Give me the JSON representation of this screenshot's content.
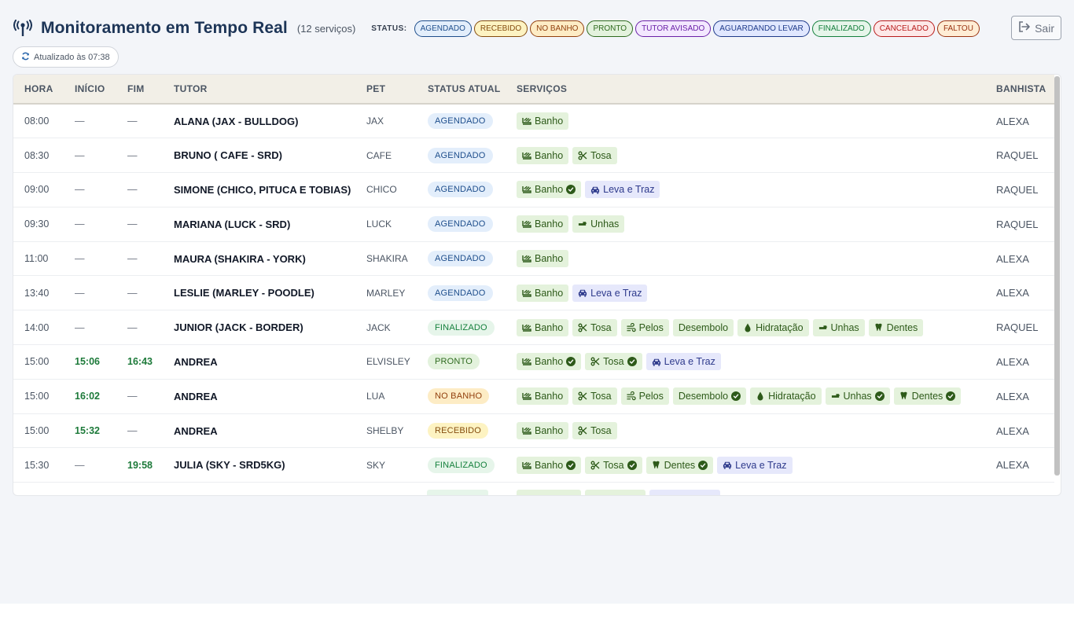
{
  "header": {
    "title": "Monitoramento em Tempo Real",
    "count": "(12 serviços)",
    "status_label": "STATUS:",
    "legend": [
      {
        "label": "AGENDADO",
        "color": "#1e4e8c",
        "bg": "#e3eefb"
      },
      {
        "label": "RECEBIDO",
        "color": "#854d0e",
        "bg": "#fdf3c2"
      },
      {
        "label": "NO BANHO",
        "color": "#92400e",
        "bg": "#fdecc5"
      },
      {
        "label": "PRONTO",
        "color": "#2f6b1f",
        "bg": "#e3f2dd"
      },
      {
        "label": "TUTOR AVISADO",
        "color": "#6b21a8",
        "bg": "#f3e8ff"
      },
      {
        "label": "AGUARDANDO LEVAR",
        "color": "#1e3a8a",
        "bg": "#e0e7ff"
      },
      {
        "label": "FINALIZADO",
        "color": "#15803d",
        "bg": "#e6f5ea"
      },
      {
        "label": "CANCELADO",
        "color": "#b91c1c",
        "bg": "#fde8e8"
      },
      {
        "label": "FALTOU",
        "color": "#9a3412",
        "bg": "#ffedd5"
      }
    ],
    "logout_label": "Sair"
  },
  "updated_label": "Atualizado às 07:38",
  "table": {
    "columns": [
      "HORA",
      "INÍCIO",
      "FIM",
      "TUTOR",
      "PET",
      "STATUS ATUAL",
      "SERVIÇOS",
      "BANHISTA"
    ],
    "rows": [
      {
        "hora": "08:00",
        "inicio": "—",
        "fim": "—",
        "tutor": "ALANA (JAX - BULLDOG)",
        "pet": "JAX",
        "status": "AGENDADO",
        "status_key": "agendado",
        "servicos": [
          {
            "label": "Banho",
            "icon": "bath-icon",
            "done": false
          }
        ],
        "banhista": "ALEXA"
      },
      {
        "hora": "08:30",
        "inicio": "—",
        "fim": "—",
        "tutor": "BRUNO ( CAFE - SRD)",
        "pet": "CAFE",
        "status": "AGENDADO",
        "status_key": "agendado",
        "servicos": [
          {
            "label": "Banho",
            "icon": "bath-icon",
            "done": false
          },
          {
            "label": "Tosa",
            "icon": "scissors-icon",
            "done": false
          }
        ],
        "banhista": "RAQUEL"
      },
      {
        "hora": "09:00",
        "inicio": "—",
        "fim": "—",
        "tutor": "SIMONE (CHICO, PITUCA E TOBIAS)",
        "pet": "CHICO",
        "status": "AGENDADO",
        "status_key": "agendado",
        "servicos": [
          {
            "label": "Banho",
            "icon": "bath-icon",
            "done": true
          },
          {
            "label": "Leva e Traz",
            "icon": "car-icon",
            "done": false,
            "transport": true
          }
        ],
        "banhista": "RAQUEL"
      },
      {
        "hora": "09:30",
        "inicio": "—",
        "fim": "—",
        "tutor": "MARIANA (LUCK - SRD)",
        "pet": "LUCK",
        "status": "AGENDADO",
        "status_key": "agendado",
        "servicos": [
          {
            "label": "Banho",
            "icon": "bath-icon",
            "done": false
          },
          {
            "label": "Unhas",
            "icon": "hand-icon",
            "done": false
          }
        ],
        "banhista": "RAQUEL"
      },
      {
        "hora": "11:00",
        "inicio": "—",
        "fim": "—",
        "tutor": "MAURA (SHAKIRA - YORK)",
        "pet": "SHAKIRA",
        "status": "AGENDADO",
        "status_key": "agendado",
        "servicos": [
          {
            "label": "Banho",
            "icon": "bath-icon",
            "done": false
          }
        ],
        "banhista": "ALEXA"
      },
      {
        "hora": "13:40",
        "inicio": "—",
        "fim": "—",
        "tutor": "LESLIE (MARLEY - POODLE)",
        "pet": "MARLEY",
        "status": "AGENDADO",
        "status_key": "agendado",
        "servicos": [
          {
            "label": "Banho",
            "icon": "bath-icon",
            "done": false
          },
          {
            "label": "Leva e Traz",
            "icon": "car-icon",
            "done": false,
            "transport": true
          }
        ],
        "banhista": "ALEXA"
      },
      {
        "hora": "14:00",
        "inicio": "—",
        "fim": "—",
        "tutor": "JUNIOR (JACK - BORDER)",
        "pet": "JACK",
        "status": "FINALIZADO",
        "status_key": "finalizado",
        "servicos": [
          {
            "label": "Banho",
            "icon": "bath-icon",
            "done": false
          },
          {
            "label": "Tosa",
            "icon": "scissors-icon",
            "done": false
          },
          {
            "label": "Pelos",
            "icon": "wind-icon",
            "done": false
          },
          {
            "label": "Desembolo",
            "icon": "",
            "done": false
          },
          {
            "label": "Hidratação",
            "icon": "drop-icon",
            "done": false
          },
          {
            "label": "Unhas",
            "icon": "hand-icon",
            "done": false
          },
          {
            "label": "Dentes",
            "icon": "tooth-icon",
            "done": false
          }
        ],
        "banhista": "RAQUEL"
      },
      {
        "hora": "15:00",
        "inicio": "15:06",
        "fim": "16:43",
        "tutor": "ANDREA",
        "pet": "ELVISLEY",
        "status": "PRONTO",
        "status_key": "pronto",
        "servicos": [
          {
            "label": "Banho",
            "icon": "bath-icon",
            "done": true
          },
          {
            "label": "Tosa",
            "icon": "scissors-icon",
            "done": true
          },
          {
            "label": "Leva e Traz",
            "icon": "car-icon",
            "done": false,
            "transport": true
          }
        ],
        "banhista": "ALEXA"
      },
      {
        "hora": "15:00",
        "inicio": "16:02",
        "fim": "—",
        "tutor": "ANDREA",
        "pet": "LUA",
        "status": "NO BANHO",
        "status_key": "nobanho",
        "servicos": [
          {
            "label": "Banho",
            "icon": "bath-icon",
            "done": false
          },
          {
            "label": "Tosa",
            "icon": "scissors-icon",
            "done": false
          },
          {
            "label": "Pelos",
            "icon": "wind-icon",
            "done": false
          },
          {
            "label": "Desembolo",
            "icon": "",
            "done": true
          },
          {
            "label": "Hidratação",
            "icon": "drop-icon",
            "done": false
          },
          {
            "label": "Unhas",
            "icon": "hand-icon",
            "done": true
          },
          {
            "label": "Dentes",
            "icon": "tooth-icon",
            "done": true
          }
        ],
        "banhista": "ALEXA"
      },
      {
        "hora": "15:00",
        "inicio": "15:32",
        "fim": "—",
        "tutor": "ANDREA",
        "pet": "SHELBY",
        "status": "RECEBIDO",
        "status_key": "recebido",
        "servicos": [
          {
            "label": "Banho",
            "icon": "bath-icon",
            "done": false
          },
          {
            "label": "Tosa",
            "icon": "scissors-icon",
            "done": false
          }
        ],
        "banhista": "ALEXA"
      },
      {
        "hora": "15:30",
        "inicio": "—",
        "fim": "19:58",
        "tutor": "JULIA (SKY - SRD5KG)",
        "pet": "SKY",
        "status": "FINALIZADO",
        "status_key": "finalizado",
        "servicos": [
          {
            "label": "Banho",
            "icon": "bath-icon",
            "done": true
          },
          {
            "label": "Tosa",
            "icon": "scissors-icon",
            "done": true
          },
          {
            "label": "Dentes",
            "icon": "tooth-icon",
            "done": true
          },
          {
            "label": "Leva e Traz",
            "icon": "car-icon",
            "done": false,
            "transport": true
          }
        ],
        "banhista": "ALEXA"
      }
    ]
  }
}
